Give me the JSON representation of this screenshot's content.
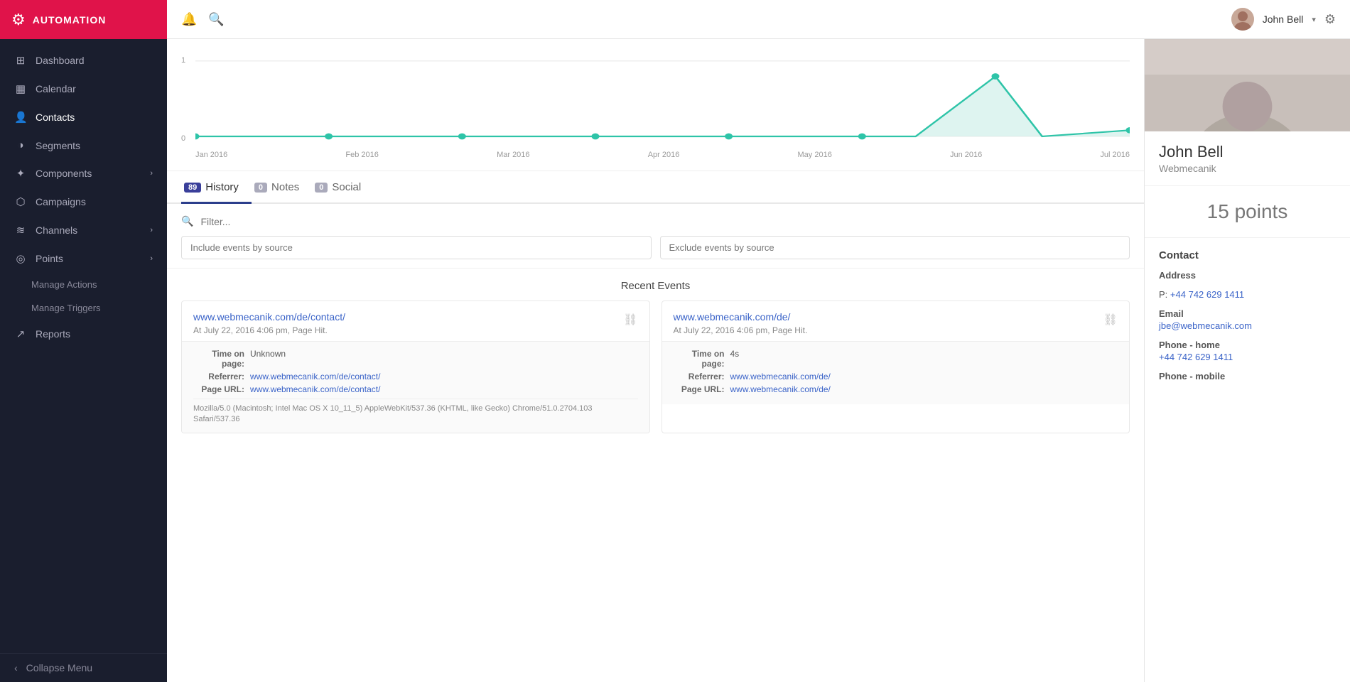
{
  "sidebar": {
    "logo_text": "AUTOMATION",
    "items": [
      {
        "id": "dashboard",
        "label": "Dashboard",
        "icon": "⊞",
        "active": false
      },
      {
        "id": "calendar",
        "label": "Calendar",
        "icon": "📅",
        "active": false
      },
      {
        "id": "contacts",
        "label": "Contacts",
        "icon": "👤",
        "active": true
      },
      {
        "id": "segments",
        "label": "Segments",
        "icon": "◑",
        "active": false
      },
      {
        "id": "components",
        "label": "Components",
        "icon": "✦",
        "active": false,
        "hasChevron": true
      },
      {
        "id": "campaigns",
        "label": "Campaigns",
        "icon": "⬡",
        "active": false
      },
      {
        "id": "channels",
        "label": "Channels",
        "icon": "≋",
        "active": false,
        "hasChevron": true
      },
      {
        "id": "points",
        "label": "Points",
        "icon": "◎",
        "active": false,
        "hasChevron": true
      }
    ],
    "submenu_items": [
      {
        "id": "manage-actions",
        "label": "Manage Actions"
      },
      {
        "id": "manage-triggers",
        "label": "Manage Triggers"
      }
    ],
    "reports_label": "Reports",
    "collapse_label": "Collapse Menu"
  },
  "topbar": {
    "user_name": "John Bell",
    "bell_icon": "🔔",
    "search_icon": "🔍",
    "gear_icon": "⚙",
    "dropdown_arrow": "▾"
  },
  "chart": {
    "y_labels": [
      "1",
      "0"
    ],
    "x_labels": [
      "Jan 2016",
      "Feb 2016",
      "Mar 2016",
      "Apr 2016",
      "May 2016",
      "Jun 2016",
      "Jul 2016"
    ]
  },
  "tabs": [
    {
      "id": "history",
      "label": "History",
      "badge": "89",
      "badge_zero": false,
      "active": true
    },
    {
      "id": "notes",
      "label": "Notes",
      "badge": "0",
      "badge_zero": true,
      "active": false
    },
    {
      "id": "social",
      "label": "Social",
      "badge": "0",
      "badge_zero": true,
      "active": false
    }
  ],
  "filter": {
    "placeholder": "Filter...",
    "include_placeholder": "Include events by source",
    "exclude_placeholder": "Exclude events by source"
  },
  "recent_events_label": "Recent Events",
  "events": [
    {
      "url": "www.webmecanik.com/de/contact/",
      "subtitle": "At July 22, 2016 4:06 pm, Page Hit.",
      "details": [
        {
          "label": "Time on page:",
          "value": "Unknown",
          "is_link": false
        },
        {
          "label": "Referrer:",
          "value": "www.webmecanik.com/de/contact/",
          "is_link": true
        },
        {
          "label": "Page URL:",
          "value": "www.webmecanik.com/de/contact/",
          "is_link": true
        }
      ],
      "ua": "Mozilla/5.0 (Macintosh; Intel Mac OS X 10_11_5) AppleWebKit/537.36 (KHTML, like Gecko) Chrome/51.0.2704.103 Safari/537.36"
    },
    {
      "url": "www.webmecanik.com/de/",
      "subtitle": "At July 22, 2016 4:06 pm, Page Hit.",
      "details": [
        {
          "label": "Time on page:",
          "value": "4s",
          "is_link": false
        },
        {
          "label": "Referrer:",
          "value": "www.webmecanik.com/de/",
          "is_link": true
        },
        {
          "label": "Page URL:",
          "value": "www.webmecanik.com/de/",
          "is_link": true
        }
      ],
      "ua": ""
    }
  ],
  "right_panel": {
    "name": "John Bell",
    "company": "Webmecanik",
    "points": "15 points",
    "contact_section": "Contact",
    "address_label": "Address",
    "phone_label": "P:",
    "phone_value": "+44 742 629 1411",
    "email_label": "Email",
    "email_value": "jbe@webmecanik.com",
    "phone_home_label": "Phone - home",
    "phone_home_value": "+44 742 629 1411",
    "phone_mobile_label": "Phone - mobile",
    "phone_mobile_value": ""
  }
}
